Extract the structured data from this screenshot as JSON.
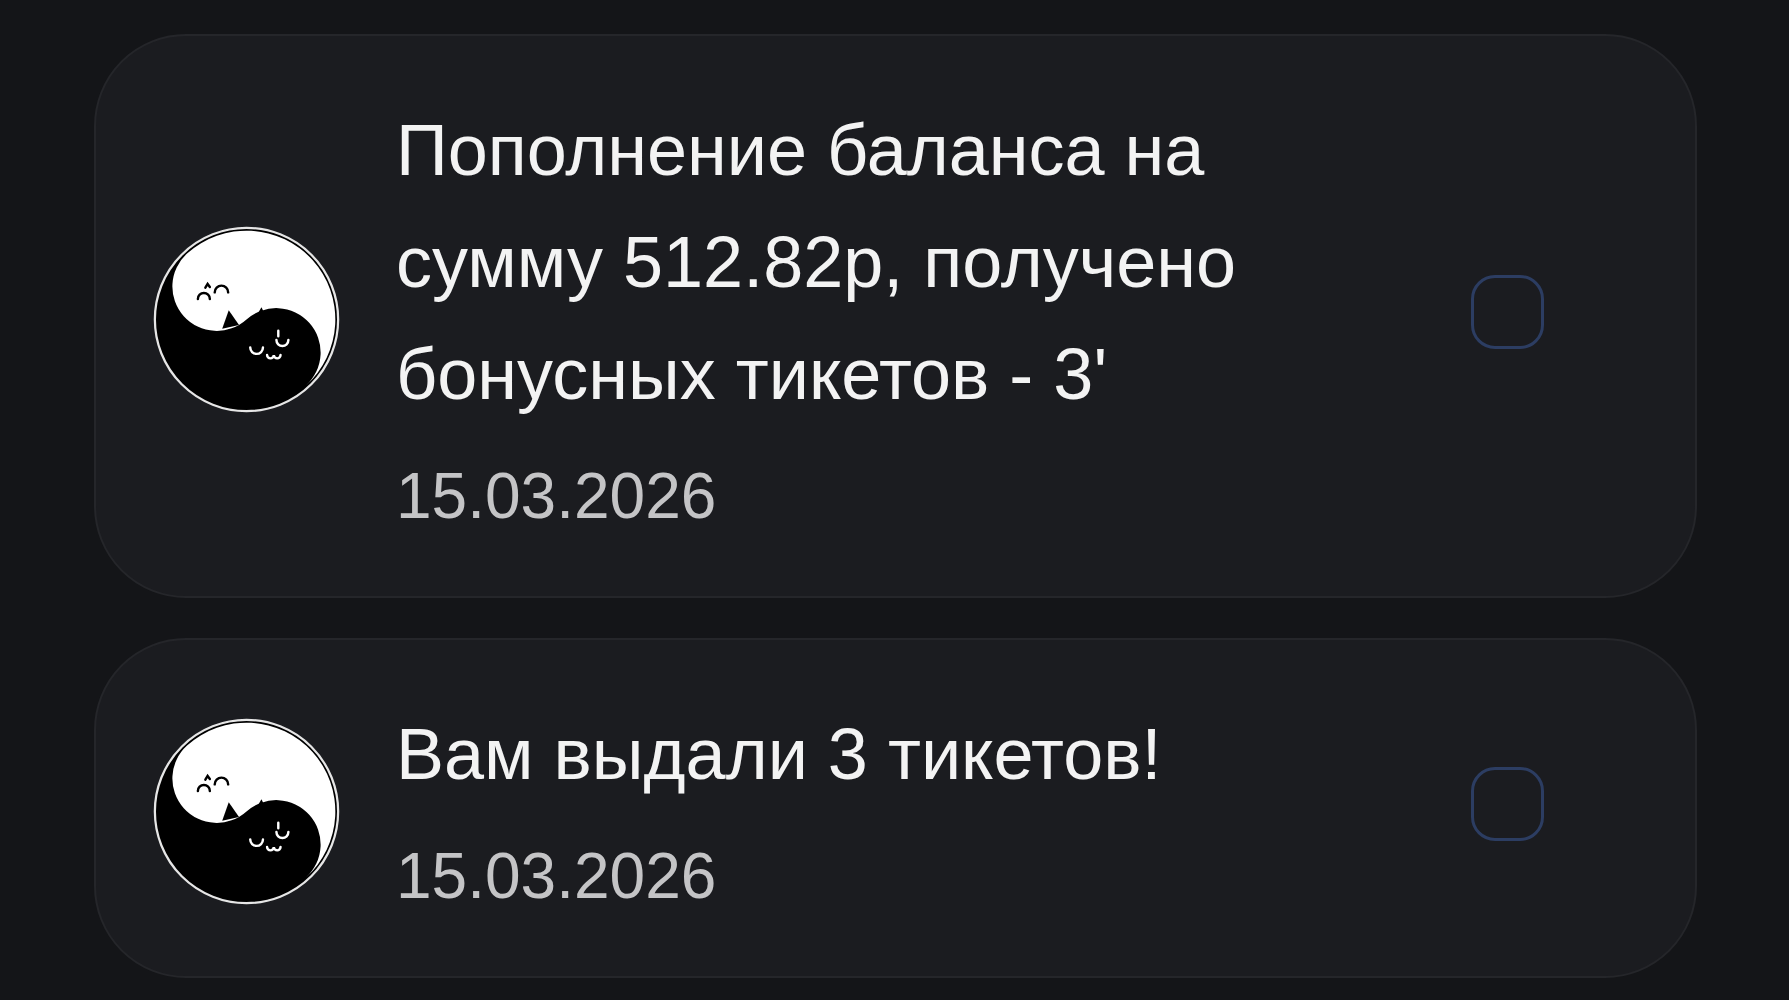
{
  "notifications": [
    {
      "message": "Пополнение баланса на сумму 512.82р, получено бонусных тикетов - 3'",
      "date": "15.03.2026",
      "checked": false
    },
    {
      "message": "Вам выдали 3 тикетов!",
      "date": "15.03.2026",
      "checked": false
    }
  ]
}
